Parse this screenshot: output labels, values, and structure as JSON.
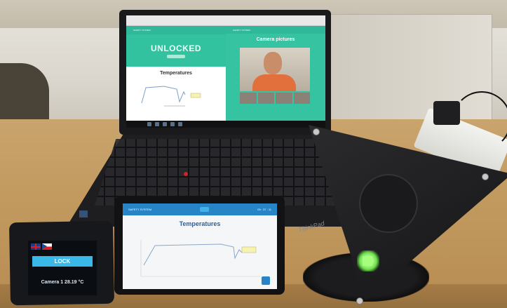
{
  "laptop": {
    "left_window": {
      "brand": "SAFETY SYSTEM",
      "status_text": "UNLOCKED",
      "section_title": "Temperatures"
    },
    "right_window": {
      "brand": "SAFETY SYSTEM",
      "section_title": "Camera pictures"
    },
    "logo": "ThinkPad"
  },
  "tablet": {
    "brand": "SAFETY SYSTEM",
    "time": "09 : 37 : 11",
    "section_title": "Temperatures"
  },
  "small_display": {
    "lock_label": "LOCK",
    "camera_readout": "Camera 1  28.19 °C"
  },
  "colors": {
    "teal": "#32c2a0",
    "blue": "#2784c6",
    "led_green": "#6ee04a"
  }
}
